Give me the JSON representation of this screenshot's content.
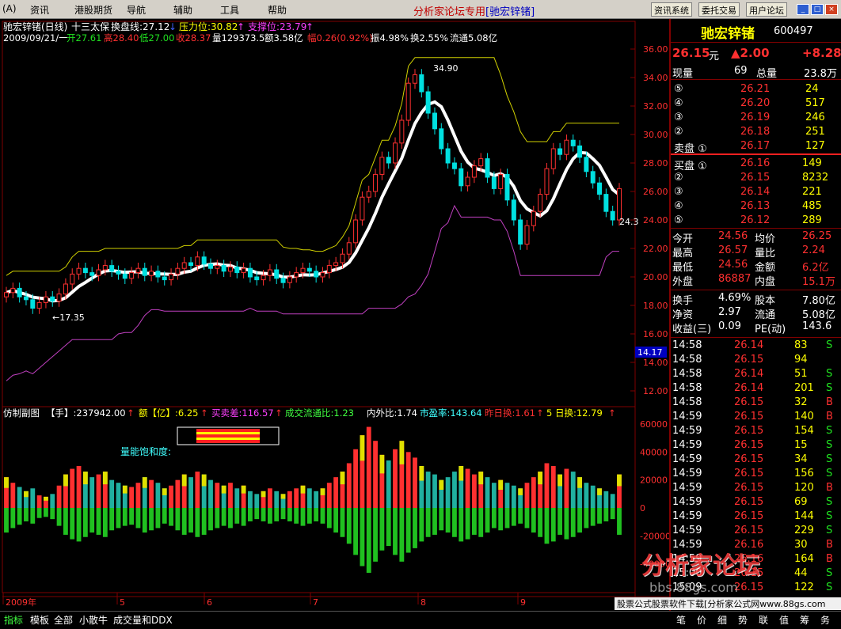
{
  "menubar": {
    "items": [
      "资讯",
      "港股期货",
      "导航",
      "辅助",
      "工具",
      "帮助"
    ],
    "title": "分析家论坛专用",
    "title_sub": "[驰宏锌锗]",
    "buttons": [
      "资讯系统",
      "委托交易",
      "用户论坛"
    ]
  },
  "chart": {
    "header1": {
      "name": "驰宏锌锗(日线)",
      "indicator": "十三太保",
      "turnover_line": "换盘线:27.12",
      "pressure": "压力位:30.82",
      "support": "支撑位:23.79"
    },
    "header2": {
      "date": "2009/09/21/一",
      "open": "开27.61",
      "high": "高28.40",
      "low": "低27.00",
      "close": "收28.37",
      "vol": "量129373.5",
      "amount": "额3.58亿",
      "change": "幅0.26(0.92%)",
      "amplitude": "振4.98%",
      "turnover": "换2.55%",
      "float": "流通5.08亿"
    },
    "yaxis_labels": [
      "36.00",
      "34.00",
      "32.00",
      "30.00",
      "28.00",
      "26.00",
      "24.00",
      "22.00",
      "20.00",
      "18.00",
      "16.00",
      "14.00",
      "12.00"
    ],
    "current_price_tag": "14.17",
    "annotations": {
      "high": "34.90",
      "low": "17.35",
      "last": "24.3"
    },
    "sub_header": {
      "name": "仿制副图",
      "vol_label": "【手】:237942.00",
      "amt_label": "额【亿】:6.25",
      "buysell": "买卖差:116.57",
      "flowratio": "成交流通比:1.23",
      "inout": "内外比:1.74",
      "pe": "市盈率:143.64",
      "yesterday": "昨日换:1.61",
      "five_day": "5 日换:12.79"
    },
    "saturation_label": "量能饱和度:",
    "sub_yaxis": [
      "60000",
      "40000",
      "20000",
      "0",
      "-20000",
      "-40000"
    ],
    "xaxis": [
      "2009年",
      "5",
      "6",
      "7",
      "8",
      "9"
    ],
    "colors": {
      "up": "#ff3030",
      "down": "#00e0e0",
      "ma": "#ffffff",
      "upper": "#d0d000",
      "lower": "#c040c0",
      "yellowbar": "#e0e000",
      "greenbar": "#20c020",
      "tealbar": "#20b0a0"
    }
  },
  "chart_data": {
    "type": "bar",
    "note_series": "candlestick price chart with volume sub-chart",
    "ylim": [
      11,
      37
    ],
    "closes": [
      18.9,
      19.2,
      18.6,
      18.4,
      17.8,
      18.2,
      18.6,
      18.3,
      18.8,
      19.5,
      20.2,
      20.6,
      20.3,
      20.1,
      20.5,
      20.8,
      20.4,
      20.2,
      19.9,
      20.3,
      20.6,
      20.1,
      20.4,
      20.0,
      19.8,
      20.2,
      20.6,
      21.0,
      20.8,
      21.4,
      20.9,
      20.6,
      20.8,
      20.4,
      20.7,
      20.3,
      20.6,
      20.0,
      19.8,
      20.1,
      20.5,
      19.9,
      19.6,
      20.0,
      20.3,
      20.6,
      20.4,
      20.0,
      20.3,
      20.8,
      21.0,
      21.6,
      22.4,
      24.0,
      25.6,
      26.0,
      27.2,
      28.4,
      28.0,
      29.4,
      31.0,
      33.6,
      34.2,
      33.0,
      31.5,
      30.4,
      29.0,
      28.0,
      27.6,
      26.4,
      27.0,
      27.8,
      28.3,
      27.0,
      26.2,
      27.2,
      25.4,
      24.0,
      22.3,
      23.6,
      24.6,
      25.8,
      27.6,
      29.0,
      28.6,
      29.6,
      29.2,
      28.4,
      27.4,
      26.6,
      25.8,
      24.6,
      24.0,
      26.2
    ],
    "volumes": [
      22000,
      18000,
      15000,
      12000,
      14000,
      9000,
      8000,
      10000,
      16000,
      24000,
      28000,
      30000,
      26000,
      22000,
      24000,
      26000,
      20000,
      18000,
      16000,
      15000,
      18000,
      22000,
      20000,
      18000,
      14000,
      16000,
      20000,
      24000,
      22000,
      26000,
      24000,
      20000,
      18000,
      16000,
      18000,
      14000,
      16000,
      12000,
      10000,
      12000,
      14000,
      12000,
      10000,
      12000,
      14000,
      16000,
      14000,
      12000,
      14000,
      18000,
      22000,
      26000,
      32000,
      42000,
      52000,
      58000,
      48000,
      38000,
      34000,
      42000,
      48000,
      40000,
      36000,
      30000,
      26000,
      24000,
      20000,
      22000,
      26000,
      30000,
      28000,
      24000,
      26000,
      22000,
      18000,
      20000,
      18000,
      16000,
      14000,
      18000,
      22000,
      26000,
      32000,
      30000,
      24000,
      28000,
      26000,
      22000,
      18000,
      16000,
      14000,
      12000,
      10000,
      24000
    ],
    "xlabel_ticks": [
      "2009年",
      "5",
      "6",
      "7",
      "8",
      "9"
    ]
  },
  "quote": {
    "name": "驰宏锌锗",
    "code": "600497",
    "price": "26.15",
    "price_unit": "元",
    "change": "▲2.00",
    "pct": "+8.28",
    "now_label": "现量",
    "now_val": "69",
    "total_label": "总量",
    "total_val": "23.8万",
    "asks": [
      {
        "lvl": "⑤",
        "p": "26.21",
        "v": "24"
      },
      {
        "lvl": "④",
        "p": "26.20",
        "v": "517"
      },
      {
        "lvl": "③",
        "p": "26.19",
        "v": "246"
      },
      {
        "lvl": "②",
        "p": "26.18",
        "v": "251"
      },
      {
        "lvl": "卖盘 ①",
        "p": "26.17",
        "v": "127"
      }
    ],
    "bids": [
      {
        "lvl": "买盘 ①",
        "p": "26.16",
        "v": "149"
      },
      {
        "lvl": "②",
        "p": "26.15",
        "v": "8232"
      },
      {
        "lvl": "③",
        "p": "26.14",
        "v": "221"
      },
      {
        "lvl": "④",
        "p": "26.13",
        "v": "485"
      },
      {
        "lvl": "⑤",
        "p": "26.12",
        "v": "289"
      }
    ],
    "stats": [
      {
        "l1": "今开",
        "v1": "24.56",
        "l2": "均价",
        "v2": "26.25"
      },
      {
        "l1": "最高",
        "v1": "26.57",
        "l2": "量比",
        "v2": "2.24"
      },
      {
        "l1": "最低",
        "v1": "24.56",
        "l2": "金额",
        "v2": "6.2亿"
      },
      {
        "l1": "外盘",
        "v1": "86887",
        "l2": "内盘",
        "v2": "15.1万"
      }
    ],
    "stats2": [
      {
        "l1": "换手",
        "v1": "4.69%",
        "l2": "股本",
        "v2": "7.80亿"
      },
      {
        "l1": "净资",
        "v1": "2.97",
        "l2": "流通",
        "v2": "5.08亿"
      },
      {
        "l1": "收益(三)",
        "v1": "0.09",
        "l2": "PE(动)",
        "v2": "143.6"
      }
    ],
    "ticks": [
      {
        "t": "14:58",
        "p": "26.14",
        "v": "83",
        "f": "S"
      },
      {
        "t": "14:58",
        "p": "26.15",
        "v": "94",
        "f": ""
      },
      {
        "t": "14:58",
        "p": "26.14",
        "v": "51",
        "f": "S"
      },
      {
        "t": "14:58",
        "p": "26.14",
        "v": "201",
        "f": "S"
      },
      {
        "t": "14:58",
        "p": "26.15",
        "v": "32",
        "f": "B"
      },
      {
        "t": "14:59",
        "p": "26.15",
        "v": "140",
        "f": "B"
      },
      {
        "t": "14:59",
        "p": "26.15",
        "v": "154",
        "f": "S"
      },
      {
        "t": "14:59",
        "p": "26.15",
        "v": "15",
        "f": "S"
      },
      {
        "t": "14:59",
        "p": "26.15",
        "v": "34",
        "f": "S"
      },
      {
        "t": "14:59",
        "p": "26.15",
        "v": "156",
        "f": "S"
      },
      {
        "t": "14:59",
        "p": "26.15",
        "v": "120",
        "f": "B"
      },
      {
        "t": "14:59",
        "p": "26.15",
        "v": "69",
        "f": "S"
      },
      {
        "t": "14:59",
        "p": "26.15",
        "v": "144",
        "f": "S"
      },
      {
        "t": "14:59",
        "p": "26.15",
        "v": "229",
        "f": "S"
      },
      {
        "t": "14:59",
        "p": "26.16",
        "v": "30",
        "f": "B"
      },
      {
        "t": "14:59",
        "p": "26.16",
        "v": "164",
        "f": "B"
      },
      {
        "t": "15:00",
        "p": "26.15",
        "v": "44",
        "f": "S"
      },
      {
        "t": "15:09",
        "p": "26.15",
        "v": "122",
        "f": "S"
      }
    ]
  },
  "bottom": {
    "tabs": [
      "指标",
      "模板",
      "全部",
      "小散牛",
      "成交量和DDX"
    ],
    "right_tabs": [
      "笔",
      "价",
      "细",
      "势",
      "联",
      "值",
      "筹",
      "务"
    ]
  },
  "watermark": {
    "main": "分析家论坛",
    "url": "bbs.88gs.com",
    "footer": "股票公式股票软件下载[分析家公式网www.88gs.com"
  }
}
